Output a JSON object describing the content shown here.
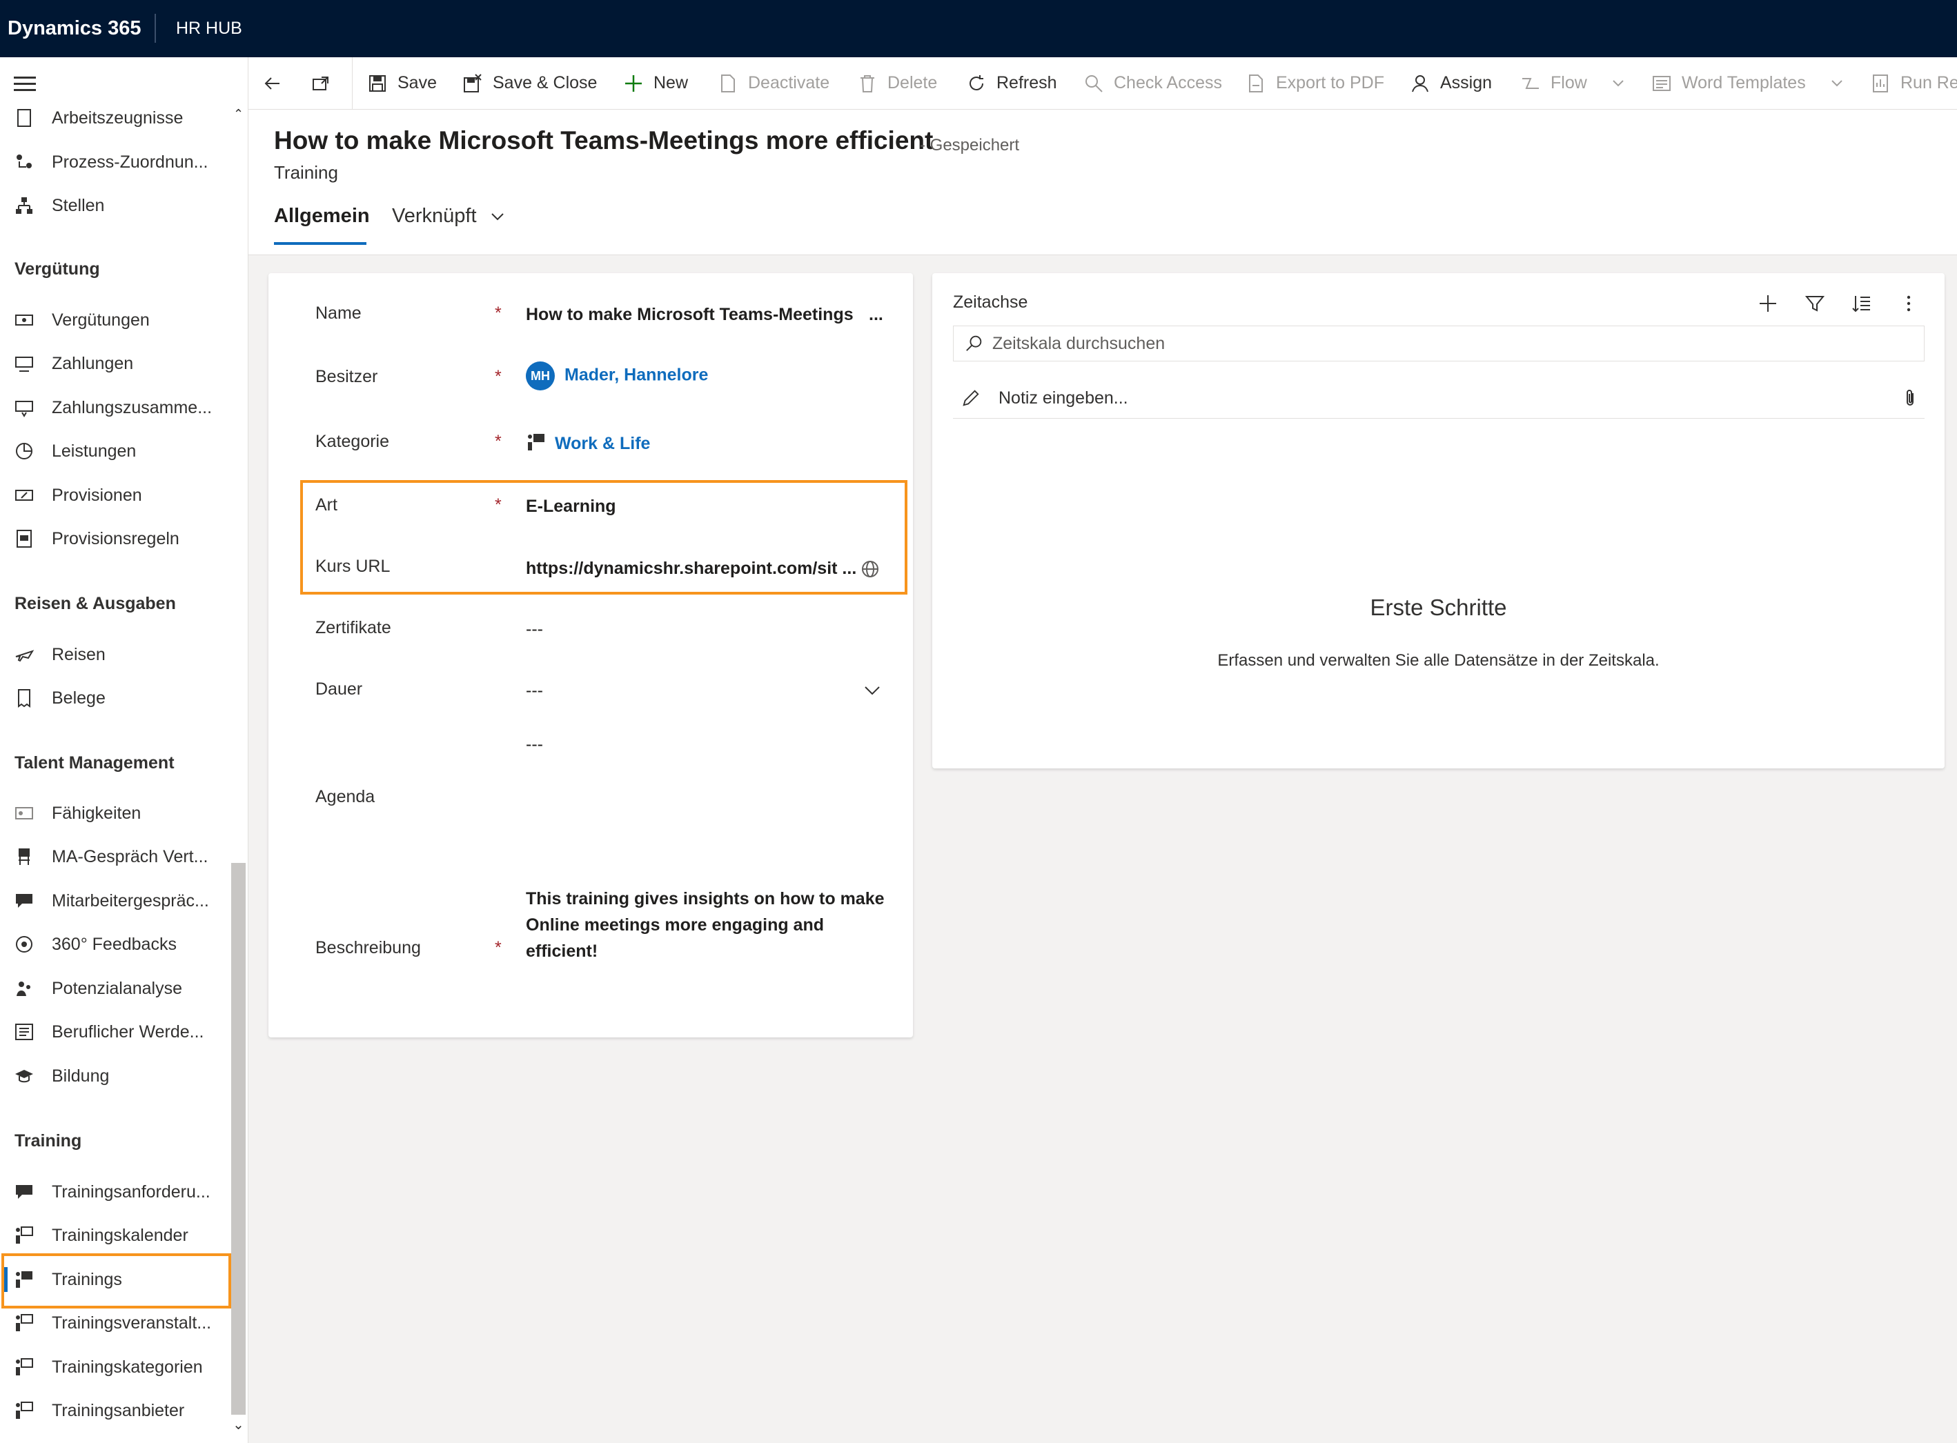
{
  "topbar": {
    "brand": "Dynamics 365",
    "app": "HR HUB"
  },
  "commands": {
    "save": "Save",
    "save_close": "Save & Close",
    "new": "New",
    "deactivate": "Deactivate",
    "delete": "Delete",
    "refresh": "Refresh",
    "check_access": "Check Access",
    "export_pdf": "Export to PDF",
    "assign": "Assign",
    "flow": "Flow",
    "word_templates": "Word Templates",
    "run_report": "Run Rep"
  },
  "sidebar": {
    "items_top": [
      "Arbeitszeugnisse",
      "Prozess-Zuordnun...",
      "Stellen"
    ],
    "section_verguetung": "Vergütung",
    "items_verguetung": [
      "Vergütungen",
      "Zahlungen",
      "Zahlungszusamme...",
      "Leistungen",
      "Provisionen",
      "Provisionsregeln"
    ],
    "section_reisen": "Reisen & Ausgaben",
    "items_reisen": [
      "Reisen",
      "Belege"
    ],
    "section_talent": "Talent Management",
    "items_talent": [
      "Fähigkeiten",
      "MA-Gespräch Vert...",
      "Mitarbeitergespräc...",
      "360° Feedbacks",
      "Potenzialanalyse",
      "Beruflicher Werde...",
      "Bildung"
    ],
    "section_training": "Training",
    "items_training": [
      "Trainingsanforderu...",
      "Trainingskalender",
      "Trainings",
      "Trainingsveranstalt...",
      "Trainingskategorien",
      "Trainingsanbieter"
    ]
  },
  "record": {
    "title": "How to make Microsoft Teams-Meetings more efficient",
    "status": "- Gespeichert",
    "entity": "Training",
    "tabs": [
      "Allgemein",
      "Verknüpft"
    ]
  },
  "form": {
    "name_label": "Name",
    "name_value": "How to make Microsoft Teams-Meetings",
    "name_more": "...",
    "owner_label": "Besitzer",
    "owner_initials": "MH",
    "owner_value": "Mader, Hannelore",
    "category_label": "Kategorie",
    "category_value": "Work & Life",
    "type_label": "Art",
    "type_value": "E-Learning",
    "url_label": "Kurs URL",
    "url_value": "https://dynamicshr.sharepoint.com/sit ...",
    "certs_label": "Zertifikate",
    "certs_value": "---",
    "duration_label": "Dauer",
    "duration_value": "---",
    "agenda_value": "---",
    "agenda_label": "Agenda",
    "desc_label": "Beschreibung",
    "desc_value": "This training gives insights on how to make Online meetings more engaging and efficient!",
    "required_mark": "*"
  },
  "timeline": {
    "title": "Zeitachse",
    "search_placeholder": "Zeitskala durchsuchen",
    "note_placeholder": "Notiz eingeben...",
    "empty_title": "Erste Schritte",
    "empty_text": "Erfassen und verwalten Sie alle Datensätze in der Zeitskala."
  },
  "colors": {
    "topbar": "#001733",
    "accent": "#0f6cbd",
    "highlight": "#f7941d",
    "required": "#a4262c"
  }
}
